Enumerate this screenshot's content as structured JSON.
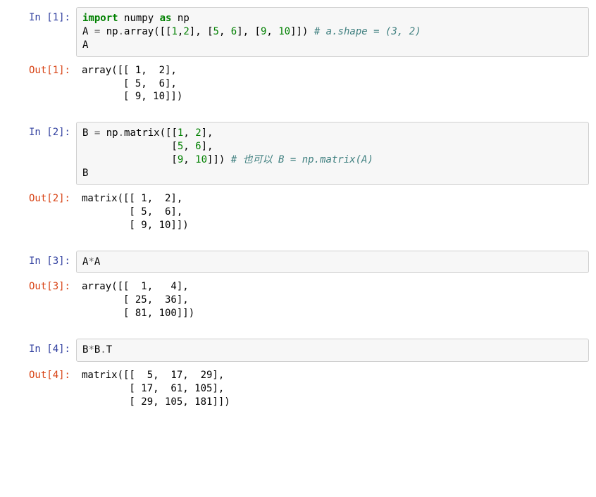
{
  "cells": [
    {
      "in_prompt": "In [1]:",
      "out_prompt": "Out[1]:",
      "code_tokens": [
        {
          "t": "import",
          "c": "tok-kw"
        },
        {
          "t": " "
        },
        {
          "t": "numpy"
        },
        {
          "t": " "
        },
        {
          "t": "as",
          "c": "tok-kw"
        },
        {
          "t": " "
        },
        {
          "t": "np"
        },
        {
          "t": "\n"
        },
        {
          "t": "A "
        },
        {
          "t": "=",
          "c": "tok-op"
        },
        {
          "t": " np"
        },
        {
          "t": ".",
          "c": "tok-op"
        },
        {
          "t": "array([["
        },
        {
          "t": "1",
          "c": "tok-num"
        },
        {
          "t": ","
        },
        {
          "t": "2",
          "c": "tok-num"
        },
        {
          "t": "], ["
        },
        {
          "t": "5",
          "c": "tok-num"
        },
        {
          "t": ", "
        },
        {
          "t": "6",
          "c": "tok-num"
        },
        {
          "t": "], ["
        },
        {
          "t": "9",
          "c": "tok-num"
        },
        {
          "t": ", "
        },
        {
          "t": "10",
          "c": "tok-num"
        },
        {
          "t": "]]) "
        },
        {
          "t": "# a.shape = (3, 2)",
          "c": "tok-cmt"
        },
        {
          "t": "\n"
        },
        {
          "t": "A"
        }
      ],
      "output": "array([[ 1,  2],\n       [ 5,  6],\n       [ 9, 10]])"
    },
    {
      "in_prompt": "In [2]:",
      "out_prompt": "Out[2]:",
      "code_tokens": [
        {
          "t": "B "
        },
        {
          "t": "=",
          "c": "tok-op"
        },
        {
          "t": " np"
        },
        {
          "t": ".",
          "c": "tok-op"
        },
        {
          "t": "matrix([["
        },
        {
          "t": "1",
          "c": "tok-num"
        },
        {
          "t": ", "
        },
        {
          "t": "2",
          "c": "tok-num"
        },
        {
          "t": "],\n"
        },
        {
          "t": "               ["
        },
        {
          "t": "5",
          "c": "tok-num"
        },
        {
          "t": ", "
        },
        {
          "t": "6",
          "c": "tok-num"
        },
        {
          "t": "],\n"
        },
        {
          "t": "               ["
        },
        {
          "t": "9",
          "c": "tok-num"
        },
        {
          "t": ", "
        },
        {
          "t": "10",
          "c": "tok-num"
        },
        {
          "t": "]]) "
        },
        {
          "t": "# 也可以 B = np.matrix(A)",
          "c": "tok-cmt"
        },
        {
          "t": "\n"
        },
        {
          "t": "B"
        }
      ],
      "output": "matrix([[ 1,  2],\n        [ 5,  6],\n        [ 9, 10]])"
    },
    {
      "in_prompt": "In [3]:",
      "out_prompt": "Out[3]:",
      "code_tokens": [
        {
          "t": "A"
        },
        {
          "t": "*",
          "c": "tok-op"
        },
        {
          "t": "A"
        }
      ],
      "output": "array([[  1,   4],\n       [ 25,  36],\n       [ 81, 100]])"
    },
    {
      "in_prompt": "In [4]:",
      "out_prompt": "Out[4]:",
      "code_tokens": [
        {
          "t": "B"
        },
        {
          "t": "*",
          "c": "tok-op"
        },
        {
          "t": "B"
        },
        {
          "t": ".",
          "c": "tok-op"
        },
        {
          "t": "T"
        }
      ],
      "output": "matrix([[  5,  17,  29],\n        [ 17,  61, 105],\n        [ 29, 105, 181]])"
    }
  ]
}
